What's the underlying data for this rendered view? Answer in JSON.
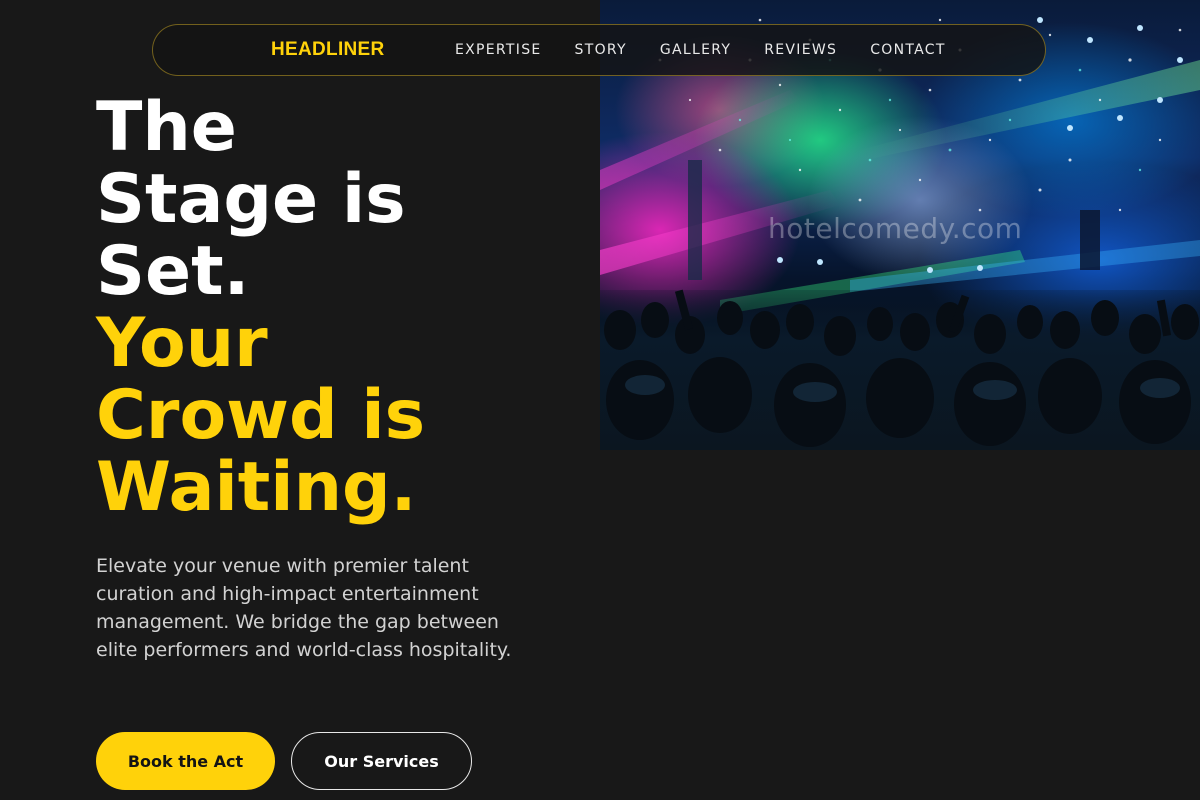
{
  "brand": "HEADLINER",
  "nav": {
    "items": [
      {
        "label": "EXPERTISE"
      },
      {
        "label": "STORY"
      },
      {
        "label": "GALLERY"
      },
      {
        "label": "REVIEWS"
      },
      {
        "label": "CONTACT"
      }
    ]
  },
  "hero": {
    "headline_white": [
      "The",
      "Stage is",
      "Set."
    ],
    "headline_gold": [
      "Your",
      "Crowd is",
      "Waiting."
    ],
    "description": "Elevate your venue with premier talent curation and high-impact entertainment management. We bridge the gap between elite performers and world-class hospitality.",
    "primary_button": "Book the Act",
    "secondary_button": "Our Services",
    "image_watermark": "hotelcomedy.com"
  },
  "colors": {
    "accent": "#ffd20a",
    "background": "#181818",
    "text_primary": "#ffffff",
    "text_secondary": "#d2d2d2"
  },
  "icons": {
    "hero_image": "concert-crowd-photo"
  }
}
